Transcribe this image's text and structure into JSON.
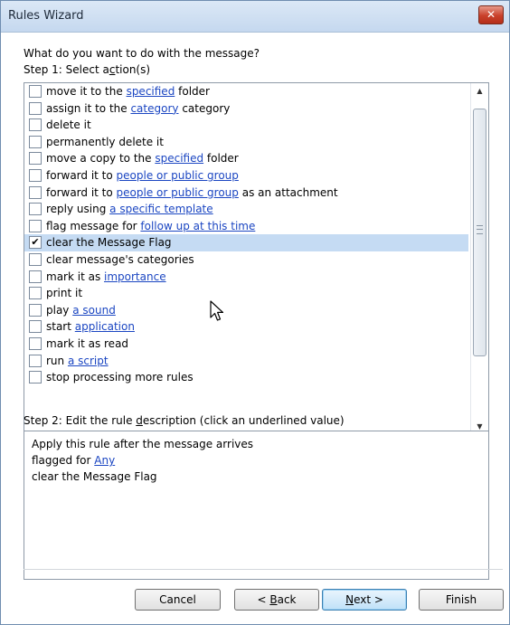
{
  "window": {
    "title": "Rules Wizard",
    "close_glyph": "✕"
  },
  "prompt": "What do you want to do with the message?",
  "step1": {
    "pre": "Step 1: Select a",
    "acc": "c",
    "post": "tion(s)"
  },
  "actions": [
    {
      "pre": "move it to the ",
      "link": "specified",
      "post": " folder",
      "checked": false
    },
    {
      "pre": "assign it to the ",
      "link": "category",
      "post": " category",
      "checked": false
    },
    {
      "pre": "delete it",
      "link": "",
      "post": "",
      "checked": false
    },
    {
      "pre": "permanently delete it",
      "link": "",
      "post": "",
      "checked": false
    },
    {
      "pre": "move a copy to the ",
      "link": "specified",
      "post": " folder",
      "checked": false
    },
    {
      "pre": "forward it to ",
      "link": "people or public group",
      "post": "",
      "checked": false
    },
    {
      "pre": "forward it to ",
      "link": "people or public group",
      "post": " as an attachment",
      "checked": false
    },
    {
      "pre": "reply using ",
      "link": "a specific template",
      "post": "",
      "checked": false
    },
    {
      "pre": "flag message for ",
      "link": "follow up at this time",
      "post": "",
      "checked": false
    },
    {
      "pre": "clear the Message Flag",
      "link": "",
      "post": "",
      "checked": true
    },
    {
      "pre": "clear message's categories",
      "link": "",
      "post": "",
      "checked": false
    },
    {
      "pre": "mark it as ",
      "link": "importance",
      "post": "",
      "checked": false
    },
    {
      "pre": "print it",
      "link": "",
      "post": "",
      "checked": false
    },
    {
      "pre": "play ",
      "link": "a sound",
      "post": "",
      "checked": false
    },
    {
      "pre": "start ",
      "link": "application",
      "post": "",
      "checked": false
    },
    {
      "pre": "mark it as read",
      "link": "",
      "post": "",
      "checked": false
    },
    {
      "pre": "run ",
      "link": "a script",
      "post": "",
      "checked": false
    },
    {
      "pre": "stop processing more rules",
      "link": "",
      "post": "",
      "checked": false
    }
  ],
  "step2": {
    "pre": "Step 2: Edit the rule ",
    "acc": "d",
    "post": "escription (click an underlined value)"
  },
  "description": {
    "line1": "Apply this rule after the message arrives",
    "line2_pre": "flagged for ",
    "line2_link": "Any",
    "line3": "clear the Message Flag"
  },
  "buttons": {
    "cancel": "Cancel",
    "back_pre": "< ",
    "back_acc": "B",
    "back_post": "ack",
    "next_acc": "N",
    "next_post": "ext >",
    "finish": "Finish"
  },
  "icons": {
    "check": "✔",
    "arrow_up": "▲",
    "arrow_down": "▼"
  },
  "colors": {
    "link": "#1b46c2",
    "selected_row": "#c5dbf3"
  }
}
